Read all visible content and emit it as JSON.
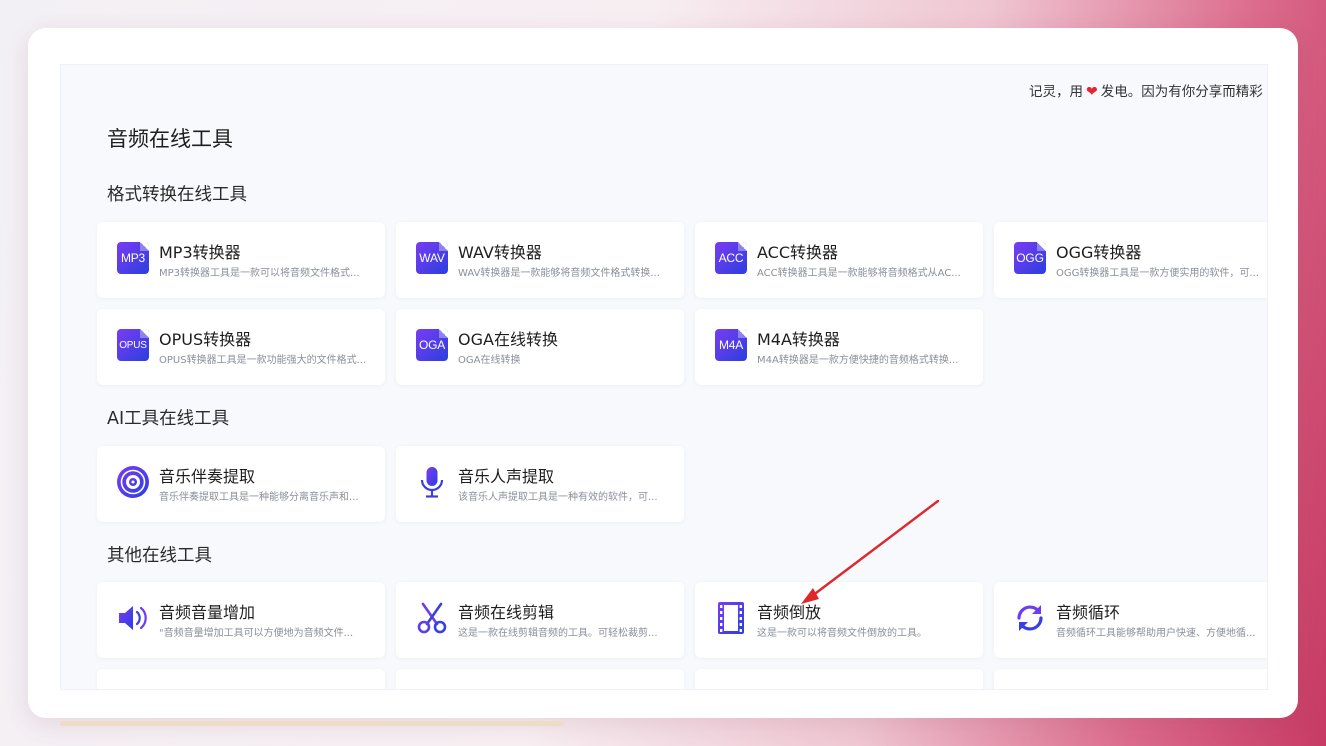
{
  "slogan": {
    "before": "记灵，用",
    "heart": "❤",
    "after": "发电。因为有你分享而精彩"
  },
  "page_title": "音频在线工具",
  "sections": {
    "format": {
      "title": "格式转换在线工具",
      "tools": [
        {
          "name": "MP3转换器",
          "desc": "MP3转换器工具是一款可以将音频文件格式...",
          "icon_label": "MP3",
          "icon": "mp3-file-icon"
        },
        {
          "name": "WAV转换器",
          "desc": "WAV转换器是一款能够将音频文件格式转换...",
          "icon_label": "WAV",
          "icon": "wav-file-icon"
        },
        {
          "name": "ACC转换器",
          "desc": "ACC转换器工具是一款能够将音频格式从AC...",
          "icon_label": "ACC",
          "icon": "acc-file-icon"
        },
        {
          "name": "OGG转换器",
          "desc": "OGG转换器工具是一款方便实用的软件，可...",
          "icon_label": "OGG",
          "icon": "ogg-file-icon"
        },
        {
          "name": "OPUS转换器",
          "desc": "OPUS转换器工具是一款功能强大的文件格式...",
          "icon_label": "OPUS",
          "icon": "opus-file-icon"
        },
        {
          "name": "OGA在线转换",
          "desc": "OGA在线转换",
          "icon_label": "OGA",
          "icon": "oga-file-icon"
        },
        {
          "name": "M4A转换器",
          "desc": "M4A转换器是一款方便快捷的音频格式转换...",
          "icon_label": "M4A",
          "icon": "m4a-file-icon"
        }
      ]
    },
    "ai": {
      "title": "AI工具在线工具",
      "tools": [
        {
          "name": "音乐伴奏提取",
          "desc": "音乐伴奏提取工具是一种能够分离音乐声和...",
          "icon": "vinyl-disc-icon"
        },
        {
          "name": "音乐人声提取",
          "desc": "该音乐人声提取工具是一种有效的软件，可...",
          "icon": "microphone-icon"
        }
      ]
    },
    "other": {
      "title": "其他在线工具",
      "tools": [
        {
          "name": "音频音量增加",
          "desc": "\"音频音量增加工具可以方便地为音频文件...",
          "icon": "speaker-volume-icon"
        },
        {
          "name": "音频在线剪辑",
          "desc": "这是一款在线剪辑音频的工具。可轻松裁剪...",
          "icon": "scissors-icon"
        },
        {
          "name": "音频倒放",
          "desc": "这是一款可以将音频文件倒放的工具。",
          "icon": "film-reverse-icon"
        },
        {
          "name": "音频循环",
          "desc": "音频循环工具能够帮助用户快速、方便地循...",
          "icon": "loop-arrows-icon"
        }
      ]
    }
  },
  "colors": {
    "icon_gradient_start": "#6a3df0",
    "icon_gradient_end": "#2f3ee0",
    "heart": "#e3262f",
    "annotation_arrow": "#e0262b"
  }
}
